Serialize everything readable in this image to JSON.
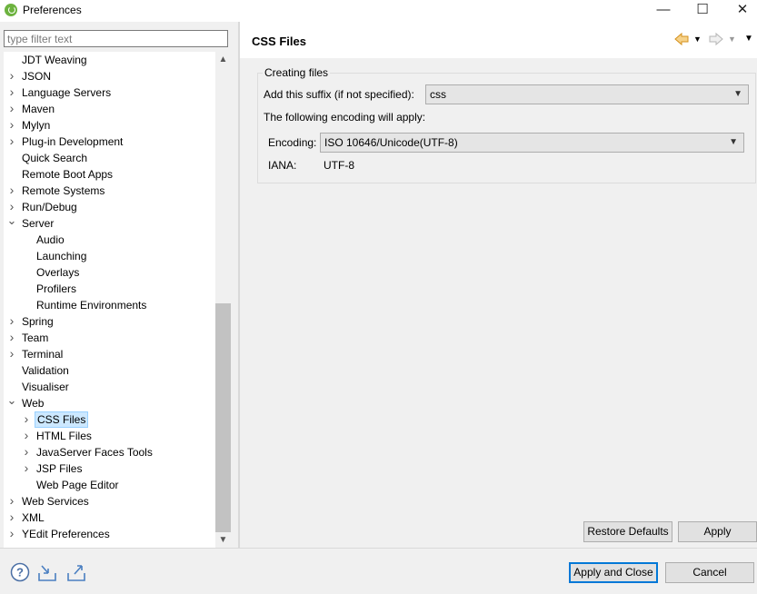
{
  "window": {
    "title": "Preferences",
    "controls": {
      "minimize": "—",
      "maximize": "☐",
      "close": "✕"
    }
  },
  "filter": {
    "placeholder": "type filter text",
    "value": ""
  },
  "tree": [
    {
      "label": "JDT Weaving",
      "level": 0,
      "expander": "none"
    },
    {
      "label": "JSON",
      "level": 0,
      "expander": "collapsed"
    },
    {
      "label": "Language Servers",
      "level": 0,
      "expander": "collapsed"
    },
    {
      "label": "Maven",
      "level": 0,
      "expander": "collapsed"
    },
    {
      "label": "Mylyn",
      "level": 0,
      "expander": "collapsed"
    },
    {
      "label": "Plug-in Development",
      "level": 0,
      "expander": "collapsed"
    },
    {
      "label": "Quick Search",
      "level": 0,
      "expander": "none"
    },
    {
      "label": "Remote Boot Apps",
      "level": 0,
      "expander": "none"
    },
    {
      "label": "Remote Systems",
      "level": 0,
      "expander": "collapsed"
    },
    {
      "label": "Run/Debug",
      "level": 0,
      "expander": "collapsed"
    },
    {
      "label": "Server",
      "level": 0,
      "expander": "expanded"
    },
    {
      "label": "Audio",
      "level": 1,
      "expander": "none"
    },
    {
      "label": "Launching",
      "level": 1,
      "expander": "none"
    },
    {
      "label": "Overlays",
      "level": 1,
      "expander": "none"
    },
    {
      "label": "Profilers",
      "level": 1,
      "expander": "none"
    },
    {
      "label": "Runtime Environments",
      "level": 1,
      "expander": "none"
    },
    {
      "label": "Spring",
      "level": 0,
      "expander": "collapsed"
    },
    {
      "label": "Team",
      "level": 0,
      "expander": "collapsed"
    },
    {
      "label": "Terminal",
      "level": 0,
      "expander": "collapsed"
    },
    {
      "label": "Validation",
      "level": 0,
      "expander": "none"
    },
    {
      "label": "Visualiser",
      "level": 0,
      "expander": "none"
    },
    {
      "label": "Web",
      "level": 0,
      "expander": "expanded"
    },
    {
      "label": "CSS Files",
      "level": 1,
      "expander": "collapsed",
      "selected": true
    },
    {
      "label": "HTML Files",
      "level": 1,
      "expander": "collapsed"
    },
    {
      "label": "JavaServer Faces Tools",
      "level": 1,
      "expander": "collapsed"
    },
    {
      "label": "JSP Files",
      "level": 1,
      "expander": "collapsed"
    },
    {
      "label": "Web Page Editor",
      "level": 1,
      "expander": "none"
    },
    {
      "label": "Web Services",
      "level": 0,
      "expander": "collapsed"
    },
    {
      "label": "XML",
      "level": 0,
      "expander": "collapsed"
    },
    {
      "label": "YEdit Preferences",
      "level": 0,
      "expander": "collapsed"
    }
  ],
  "page": {
    "title": "CSS Files",
    "group_title": "Creating files",
    "suffix_label": "Add this suffix (if not specified):",
    "suffix_value": "css",
    "encoding_note": "The following encoding will apply:",
    "encoding_label": "Encoding:",
    "encoding_value": "ISO 10646/Unicode(UTF-8)",
    "iana_label": "IANA:",
    "iana_value": "UTF-8"
  },
  "buttons": {
    "restore_defaults": "Restore Defaults",
    "apply": "Apply",
    "apply_and_close": "Apply and Close",
    "cancel": "Cancel"
  },
  "icons": {
    "app": "eclipse-spring-icon",
    "back": "back-arrow-icon",
    "forward": "forward-arrow-icon",
    "menu": "view-menu-icon",
    "help": "help-icon",
    "import": "import-icon",
    "export": "export-icon"
  },
  "colors": {
    "selection": "#cce8ff",
    "nav_back": "#e8a33d"
  }
}
